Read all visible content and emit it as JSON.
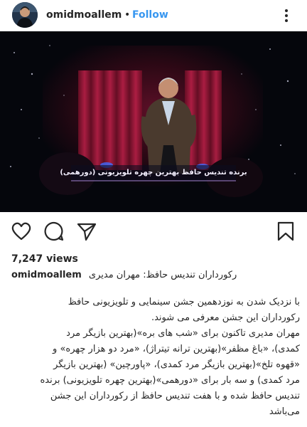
{
  "header": {
    "username": "omidmoallem",
    "separator": "•",
    "follow_label": "Follow"
  },
  "media": {
    "overlay_caption": "برنده تندیس حافظ بهترین چهره تلویزیونی (دورهمی)",
    "overlay_tag": "(دورهمی)"
  },
  "actions": {
    "like_icon": "heart-icon",
    "comment_icon": "comment-icon",
    "share_icon": "paper-plane-icon",
    "save_icon": "bookmark-icon"
  },
  "stats": {
    "views": "7,247 views"
  },
  "caption": {
    "username": "omidmoallem",
    "title": "رکورداران تندیس حافظ: مهران مدیری",
    "paragraph1": [
      "با نزدیک شدن به نوزدهمین جشن سینمایی و تلویزیونی حافظ",
      "رکورداران این جشن معرفی می شوند."
    ],
    "paragraph2": [
      "مهران مدیری تاکنون برای «شب های بره»(بهترین بازیگر مرد",
      "کمدی)، «باغ مظفر»(بهترین ترانه تیتراژ)، «مرد دو هزار چهره» و",
      "«قهوه تلخ»(بهترین بازیگر مرد کمدی)، «پاورچین» (بهترین بازیگر",
      "مرد کمدی) و سه بار برای «دورهمی»(بهترین چهره تلویزیونی) برنده",
      "تندیس حافظ شده و با هفت تندیس حافظ از رکورداران این جشن",
      "می‌باشد"
    ]
  }
}
